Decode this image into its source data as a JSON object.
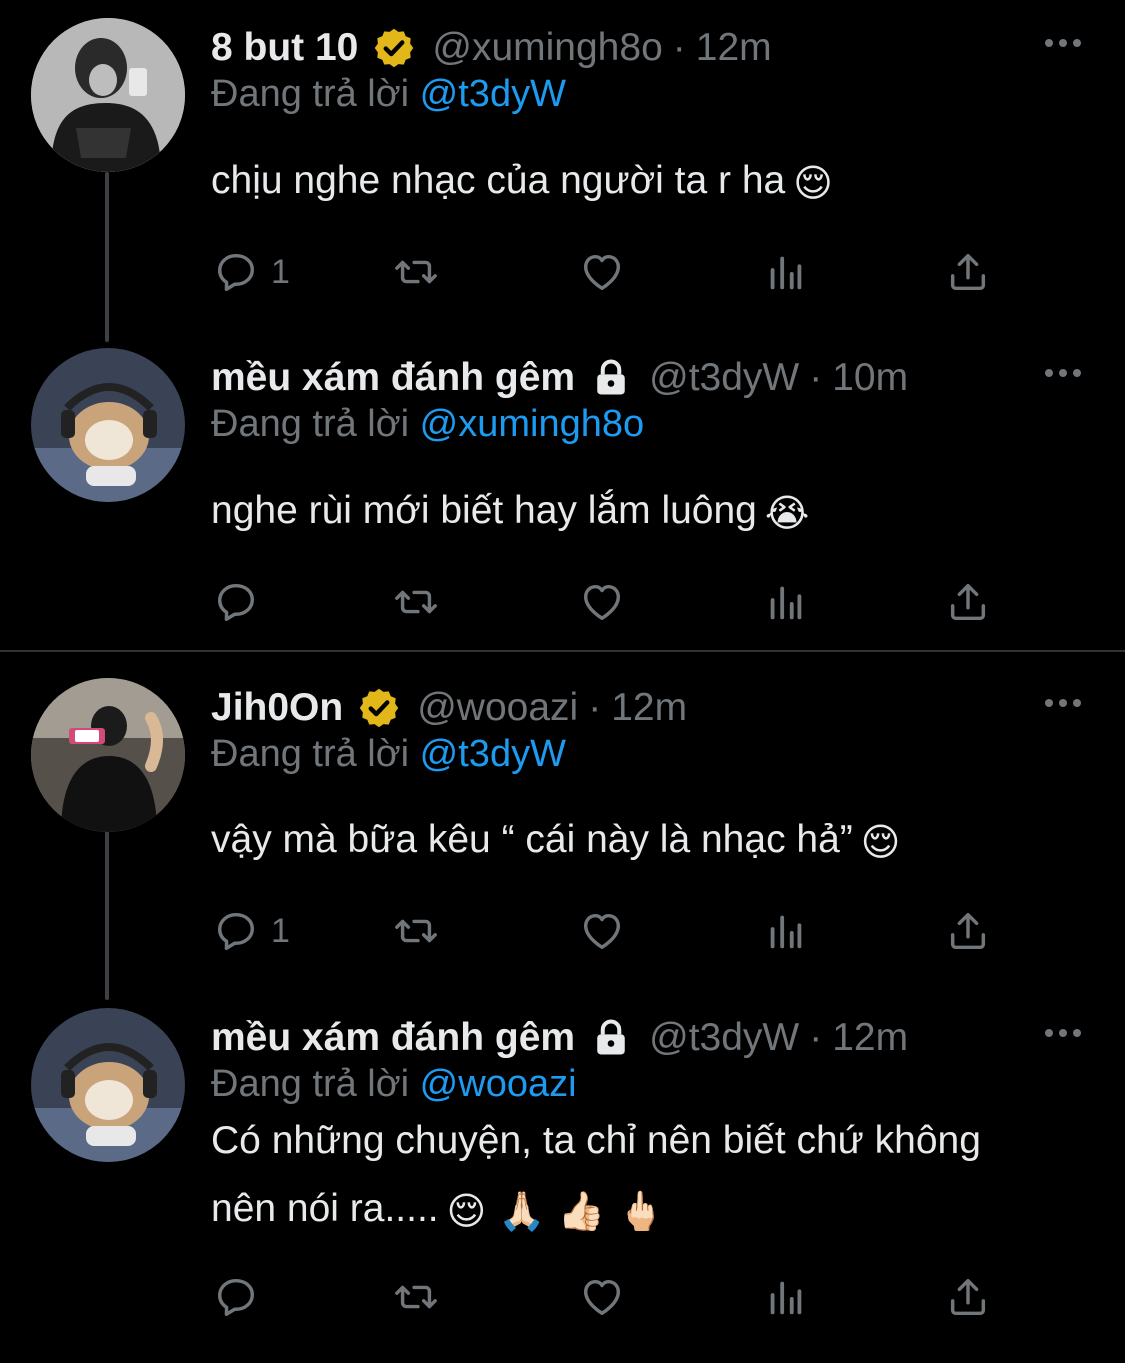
{
  "threads": [
    {
      "tweets": [
        {
          "display_name": "8 but 10",
          "badge": "verified-badge",
          "handle": "@xumingh8o",
          "dot": "·",
          "time": "12m",
          "reply_prefix": "Đang trả lời",
          "reply_to": "@t3dyW",
          "text": "chịu nghe nhạc của người ta r ha",
          "emoji": "😌",
          "reply_count": "1"
        },
        {
          "display_name": "mều xám đánh gêm",
          "badge": "lock-icon",
          "handle": "@t3dyW",
          "dot": "·",
          "time": "10m",
          "reply_prefix": "Đang trả lời",
          "reply_to": "@xumingh8o",
          "text": "nghe rùi mới biết hay lắm luông",
          "emoji": "😭",
          "reply_count": ""
        }
      ]
    },
    {
      "tweets": [
        {
          "display_name": "Jih0On",
          "badge": "verified-badge",
          "handle": "@wooazi",
          "dot": "·",
          "time": "12m",
          "reply_prefix": "Đang trả lời",
          "reply_to": "@t3dyW",
          "text": "vậy mà bữa kêu “ cái này là nhạc hả”",
          "emoji": "😌",
          "reply_count": "1"
        },
        {
          "display_name": "mều xám đánh gêm",
          "badge": "lock-icon",
          "handle": "@t3dyW",
          "dot": "·",
          "time": "12m",
          "reply_prefix": "Đang trả lời",
          "reply_to": "@wooazi",
          "text_line1": "Có những chuyện, ta chỉ nên biết chứ không",
          "text_line2": "nên nói ra.....",
          "emoji": "😌 🙏🏻 👍🏻 🖕🏻",
          "reply_count": ""
        }
      ]
    }
  ],
  "colors": {
    "background": "#000000",
    "text": "#e7e9ea",
    "muted": "#71767b",
    "link": "#1d9bf0",
    "badge_gold": "#e2b719",
    "divider": "#2f3336"
  }
}
